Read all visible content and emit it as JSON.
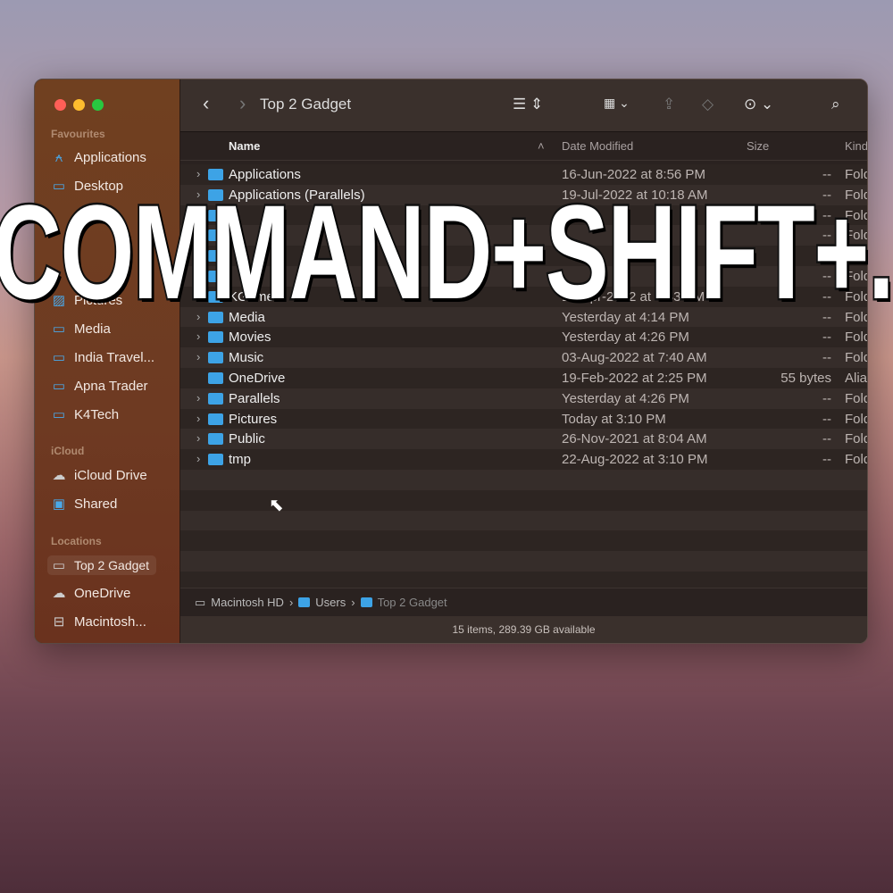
{
  "window": {
    "title": "Top 2 Gadget",
    "traffic_lights": [
      "#ff5f57",
      "#febc2e",
      "#28c840"
    ]
  },
  "sidebar": {
    "favourites_label": "Favourites",
    "favourites": [
      {
        "label": "Applications",
        "icon": "applications-icon"
      },
      {
        "label": "Desktop",
        "icon": "desktop-icon"
      },
      {
        "label": "Pictures",
        "icon": "pictures-icon"
      },
      {
        "label": "Media",
        "icon": "folder-icon"
      },
      {
        "label": "India Travel...",
        "icon": "folder-icon"
      },
      {
        "label": "Apna Trader",
        "icon": "folder-icon"
      },
      {
        "label": "K4Tech",
        "icon": "folder-icon"
      }
    ],
    "icloud_label": "iCloud",
    "icloud": [
      {
        "label": "iCloud Drive",
        "icon": "cloud-icon"
      },
      {
        "label": "Shared",
        "icon": "shared-folder-icon"
      }
    ],
    "locations_label": "Locations",
    "locations": [
      {
        "label": "Top 2 Gadget",
        "icon": "laptop-icon"
      },
      {
        "label": "OneDrive",
        "icon": "cloud-icon"
      },
      {
        "label": "Macintosh...",
        "icon": "drive-icon"
      }
    ]
  },
  "columns": {
    "name": "Name",
    "date": "Date Modified",
    "size": "Size",
    "kind": "Kind"
  },
  "files": [
    {
      "name": "Applications",
      "date": "16-Jun-2022 at 8:56 PM",
      "size": "--",
      "kind": "Folder"
    },
    {
      "name": "Applications (Parallels)",
      "date": "19-Jul-2022 at 10:18 AM",
      "size": "--",
      "kind": "Folder"
    },
    {
      "name": "",
      "date": "",
      "size": "--",
      "kind": "Folder"
    },
    {
      "name": "",
      "date": "",
      "size": "--",
      "kind": "Folder"
    },
    {
      "name": "",
      "date": "",
      "size": "--",
      "kind": "Folder"
    },
    {
      "name": "",
      "date": "",
      "size": "--",
      "kind": "Folder"
    },
    {
      "name": "KGames",
      "date": "13-Apr-2022 at 4:43 PM",
      "size": "--",
      "kind": "Folder"
    },
    {
      "name": "Media",
      "date": "Yesterday at 4:14 PM",
      "size": "--",
      "kind": "Folder"
    },
    {
      "name": "Movies",
      "date": "Yesterday at 4:26 PM",
      "size": "--",
      "kind": "Folder"
    },
    {
      "name": "Music",
      "date": "03-Aug-2022 at 7:40 AM",
      "size": "--",
      "kind": "Folder"
    },
    {
      "name": "OneDrive",
      "date": "19-Feb-2022 at 2:25 PM",
      "size": "55 bytes",
      "kind": "Alias"
    },
    {
      "name": "Parallels",
      "date": "Yesterday at 4:26 PM",
      "size": "--",
      "kind": "Folder"
    },
    {
      "name": "Pictures",
      "date": "Today at 3:10 PM",
      "size": "--",
      "kind": "Folder"
    },
    {
      "name": "Public",
      "date": "26-Nov-2021 at 8:04 AM",
      "size": "--",
      "kind": "Folder"
    },
    {
      "name": "tmp",
      "date": "22-Aug-2022 at 3:10 PM",
      "size": "--",
      "kind": "Folder"
    }
  ],
  "path": [
    "Macintosh HD",
    "Users",
    "Top 2 Gadget"
  ],
  "status": "15 items, 289.39 GB available",
  "overlay": "COMMAND+SHIFT+.",
  "colors": {
    "folder": "#3da3e6",
    "sidebar": "#6e3a22"
  }
}
